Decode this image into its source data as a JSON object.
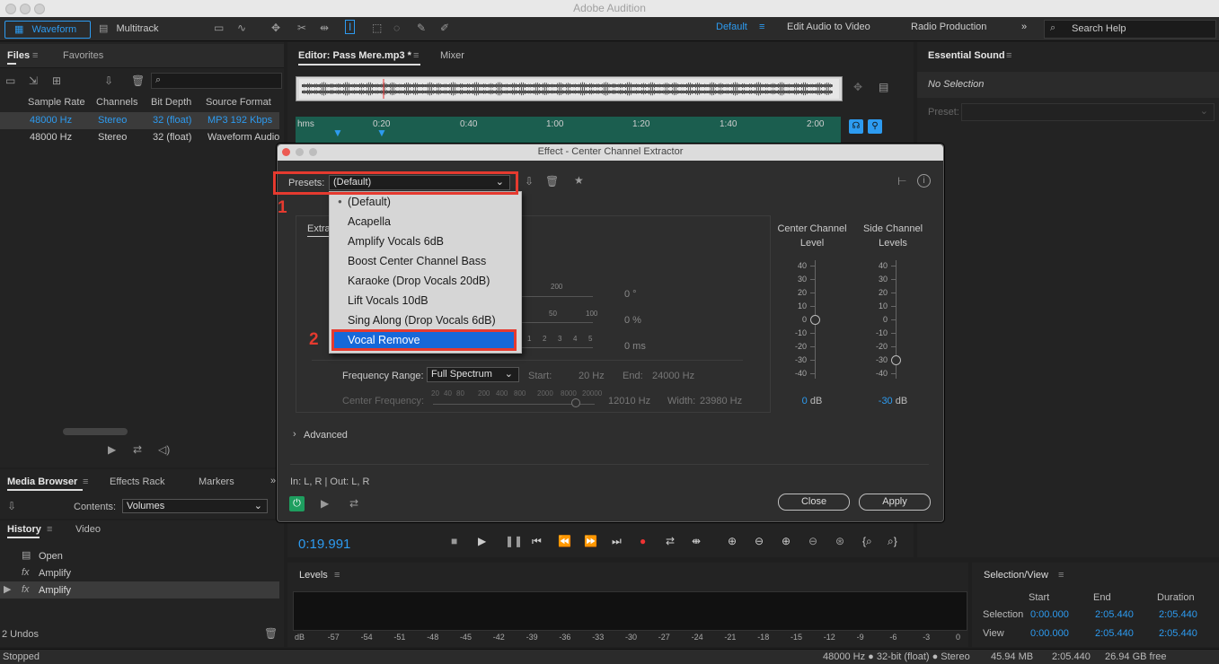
{
  "app": {
    "title": "Adobe Audition",
    "status": "Stopped"
  },
  "toolbar": {
    "waveform_label": "Waveform",
    "multitrack_label": "Multitrack",
    "workspaces": [
      "Default",
      "Edit Audio to Video",
      "Radio Production"
    ],
    "search_placeholder": "Search Help"
  },
  "files_panel": {
    "tabs": [
      "Files",
      "Favorites"
    ],
    "columns": [
      "Sample Rate",
      "Channels",
      "Bit Depth",
      "Source Format"
    ],
    "rows": [
      {
        "sample_rate": "48000 Hz",
        "channels": "Stereo",
        "bit_depth": "32 (float)",
        "source_format": "MP3 192 Kbps"
      },
      {
        "sample_rate": "48000 Hz",
        "channels": "Stereo",
        "bit_depth": "32 (float)",
        "source_format": "Waveform Audio"
      }
    ]
  },
  "editor": {
    "tab_label": "Editor: Pass Mere.mp3 *",
    "mixer_label": "Mixer",
    "ruler": [
      "hms",
      "0:20",
      "0:40",
      "1:00",
      "1:20",
      "1:40",
      "2:00"
    ],
    "time": "0:19.991"
  },
  "essential_sound": {
    "title": "Essential Sound",
    "no_selection": "No Selection",
    "preset_label": "Preset:"
  },
  "media_panel": {
    "tabs": [
      "Media Browser",
      "Effects Rack",
      "Markers"
    ],
    "contents_label": "Contents:",
    "contents_value": "Volumes"
  },
  "history": {
    "tabs": [
      "History",
      "Video"
    ],
    "items": [
      "Open",
      "Amplify",
      "Amplify"
    ],
    "undos": "2 Undos"
  },
  "levels": {
    "title": "Levels",
    "scale": [
      "dB",
      "-57",
      "-54",
      "-51",
      "-48",
      "-45",
      "-42",
      "-39",
      "-36",
      "-33",
      "-30",
      "-27",
      "-24",
      "-21",
      "-18",
      "-15",
      "-12",
      "-9",
      "-6",
      "-3",
      "0"
    ]
  },
  "selection_view": {
    "title": "Selection/View",
    "headers": [
      "Start",
      "End",
      "Duration"
    ],
    "selection": {
      "label": "Selection",
      "start": "0:00.000",
      "end": "2:05.440",
      "duration": "2:05.440"
    },
    "view": {
      "label": "View",
      "start": "0:00.000",
      "end": "2:05.440",
      "duration": "2:05.440"
    }
  },
  "statusbar": {
    "format": "48000 Hz ● 32-bit (float) ● Stereo",
    "size": "45.94 MB",
    "duration": "2:05.440",
    "free": "26.94 GB free"
  },
  "dialog": {
    "title": "Effect - Center Channel Extractor",
    "presets_label": "Presets:",
    "presets_value": "(Default)",
    "extract_tab": "Extra",
    "preset_options": [
      "(Default)",
      "Acapella",
      "Amplify Vocals 6dB",
      "Boost Center Channel Bass",
      "Karaoke (Drop Vocals 20dB)",
      "Lift Vocals 10dB",
      "Sing Along (Drop Vocals 6dB)",
      "Vocal Remove"
    ],
    "highlighted_option": "Vocal Remove",
    "step1": "1",
    "step2": "2",
    "hidden_values": {
      "v1": "0 °",
      "v2": "0 %",
      "v3": "0 ms",
      "s1": "200",
      "s2a": "50",
      "s2b": "100",
      "s3": [
        "1",
        "2",
        "3",
        "4",
        "5"
      ]
    },
    "freq_range_label": "Frequency Range:",
    "freq_range_value": "Full Spectrum",
    "start_label": "Start:",
    "start_value": "20 Hz",
    "end_label": "End:",
    "end_value": "24000 Hz",
    "center_freq_label": "Center Frequency:",
    "center_freq_scale": [
      "20",
      "40",
      "80",
      "200",
      "400",
      "800",
      "2000",
      "8000",
      "20000"
    ],
    "center_freq_value": "12010 Hz",
    "width_label": "Width:",
    "width_value": "23980 Hz",
    "center_level_label": "Center Channel Level",
    "side_level_label": "Side Channel Levels",
    "meter_scale": [
      "40",
      "30",
      "20",
      "10",
      "0",
      "-10",
      "-20",
      "-30",
      "-40"
    ],
    "center_db_value": "0",
    "side_db_value": "-30",
    "db_unit": "dB",
    "center_level_norm": 0.5,
    "side_level_norm": 0.875,
    "advanced_label": "Advanced",
    "io_label": "In: L, R | Out: L, R",
    "close_label": "Close",
    "apply_label": "Apply"
  }
}
